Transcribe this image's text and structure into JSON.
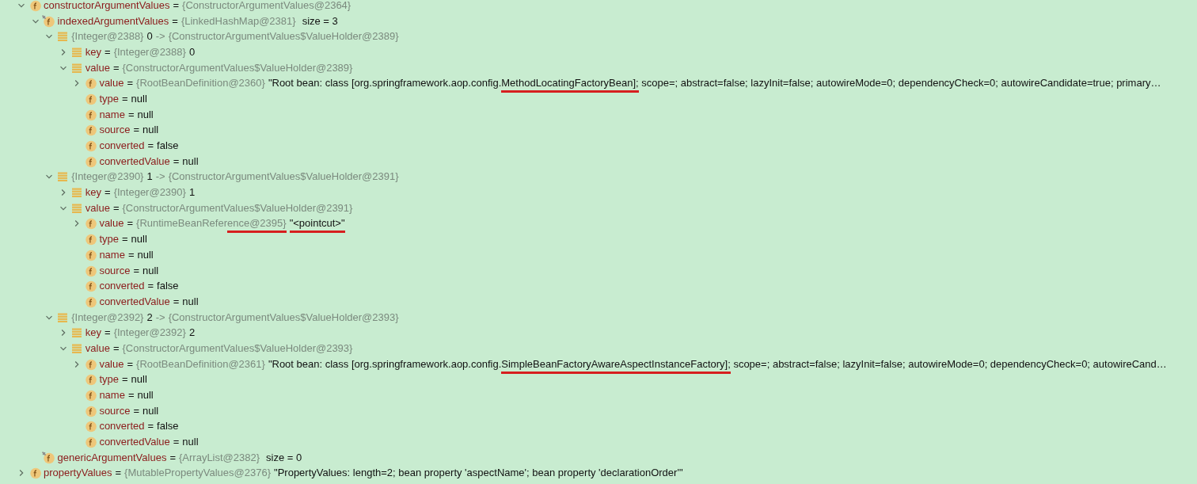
{
  "tree": [
    {
      "kind": "field",
      "expanded": true,
      "parts": [
        {
          "kind": "name",
          "segments": [
            {
              "text": "constructorArgumentValues"
            }
          ]
        },
        {
          "kind": "plain",
          "segments": [
            {
              "text": "="
            }
          ]
        },
        {
          "kind": "type",
          "segments": [
            {
              "text": "{ConstructorArgumentValues@2364}"
            }
          ]
        }
      ],
      "children": [
        {
          "kind": "field_marked",
          "expanded": true,
          "parts": [
            {
              "kind": "name",
              "segments": [
                {
                  "text": "indexedArgumentValues"
                }
              ]
            },
            {
              "kind": "plain",
              "segments": [
                {
                  "text": "="
                }
              ]
            },
            {
              "kind": "type",
              "segments": [
                {
                  "text": "{LinkedHashMap@2381}"
                }
              ]
            },
            {
              "kind": "size",
              "segments": [
                {
                  "text": "size = 3"
                }
              ]
            }
          ],
          "children": [
            {
              "kind": "entry",
              "expanded": true,
              "parts": [
                {
                  "kind": "type",
                  "segments": [
                    {
                      "text": "{Integer@2388}"
                    }
                  ]
                },
                {
                  "kind": "plain",
                  "segments": [
                    {
                      "text": "0"
                    }
                  ]
                },
                {
                  "kind": "type",
                  "segments": [
                    {
                      "text": "->"
                    }
                  ]
                },
                {
                  "kind": "type",
                  "segments": [
                    {
                      "text": "{ConstructorArgumentValues$ValueHolder@2389}"
                    }
                  ]
                }
              ],
              "children": [
                {
                  "kind": "entry",
                  "expanded": false,
                  "parts": [
                    {
                      "kind": "name",
                      "segments": [
                        {
                          "text": "key"
                        }
                      ]
                    },
                    {
                      "kind": "plain",
                      "segments": [
                        {
                          "text": "="
                        }
                      ]
                    },
                    {
                      "kind": "type",
                      "segments": [
                        {
                          "text": "{Integer@2388}"
                        }
                      ]
                    },
                    {
                      "kind": "plain",
                      "segments": [
                        {
                          "text": "0"
                        }
                      ]
                    }
                  ]
                },
                {
                  "kind": "entry",
                  "expanded": true,
                  "parts": [
                    {
                      "kind": "name",
                      "segments": [
                        {
                          "text": "value"
                        }
                      ]
                    },
                    {
                      "kind": "plain",
                      "segments": [
                        {
                          "text": "="
                        }
                      ]
                    },
                    {
                      "kind": "type",
                      "segments": [
                        {
                          "text": "{ConstructorArgumentValues$ValueHolder@2389}"
                        }
                      ]
                    }
                  ],
                  "children": [
                    {
                      "kind": "field",
                      "expanded": false,
                      "parts": [
                        {
                          "kind": "name",
                          "segments": [
                            {
                              "text": "value"
                            }
                          ]
                        },
                        {
                          "kind": "plain",
                          "segments": [
                            {
                              "text": "="
                            }
                          ]
                        },
                        {
                          "kind": "type",
                          "segments": [
                            {
                              "text": "{RootBeanDefinition@2360}"
                            }
                          ]
                        },
                        {
                          "kind": "plain",
                          "segments": [
                            {
                              "text": "\"Root bean: class [org.springframework.aop.config.",
                              "underlined": false
                            },
                            {
                              "text": "MethodLocatingFactoryBean];",
                              "underlined": true
                            },
                            {
                              "text": " scope=; abstract=false; lazyInit=false; autowireMode=0; dependencyCheck=0; autowireCandidate=true; primary…",
                              "underlined": false
                            }
                          ]
                        }
                      ]
                    },
                    {
                      "kind": "field",
                      "parts": [
                        {
                          "kind": "name",
                          "segments": [
                            {
                              "text": "type"
                            }
                          ]
                        },
                        {
                          "kind": "plain",
                          "segments": [
                            {
                              "text": "="
                            }
                          ]
                        },
                        {
                          "kind": "plain",
                          "segments": [
                            {
                              "text": "null"
                            }
                          ]
                        }
                      ]
                    },
                    {
                      "kind": "field",
                      "parts": [
                        {
                          "kind": "name",
                          "segments": [
                            {
                              "text": "name"
                            }
                          ]
                        },
                        {
                          "kind": "plain",
                          "segments": [
                            {
                              "text": "="
                            }
                          ]
                        },
                        {
                          "kind": "plain",
                          "segments": [
                            {
                              "text": "null"
                            }
                          ]
                        }
                      ]
                    },
                    {
                      "kind": "field",
                      "parts": [
                        {
                          "kind": "name",
                          "segments": [
                            {
                              "text": "source"
                            }
                          ]
                        },
                        {
                          "kind": "plain",
                          "segments": [
                            {
                              "text": "="
                            }
                          ]
                        },
                        {
                          "kind": "plain",
                          "segments": [
                            {
                              "text": "null"
                            }
                          ]
                        }
                      ]
                    },
                    {
                      "kind": "field",
                      "parts": [
                        {
                          "kind": "name",
                          "segments": [
                            {
                              "text": "converted"
                            }
                          ]
                        },
                        {
                          "kind": "plain",
                          "segments": [
                            {
                              "text": "="
                            }
                          ]
                        },
                        {
                          "kind": "plain",
                          "segments": [
                            {
                              "text": "false"
                            }
                          ]
                        }
                      ]
                    },
                    {
                      "kind": "field",
                      "parts": [
                        {
                          "kind": "name",
                          "segments": [
                            {
                              "text": "convertedValue"
                            }
                          ]
                        },
                        {
                          "kind": "plain",
                          "segments": [
                            {
                              "text": "="
                            }
                          ]
                        },
                        {
                          "kind": "plain",
                          "segments": [
                            {
                              "text": "null"
                            }
                          ]
                        }
                      ]
                    }
                  ]
                }
              ]
            },
            {
              "kind": "entry",
              "expanded": true,
              "parts": [
                {
                  "kind": "type",
                  "segments": [
                    {
                      "text": "{Integer@2390}"
                    }
                  ]
                },
                {
                  "kind": "plain",
                  "segments": [
                    {
                      "text": "1"
                    }
                  ]
                },
                {
                  "kind": "type",
                  "segments": [
                    {
                      "text": "->"
                    }
                  ]
                },
                {
                  "kind": "type",
                  "segments": [
                    {
                      "text": "{ConstructorArgumentValues$ValueHolder@2391}"
                    }
                  ]
                }
              ],
              "children": [
                {
                  "kind": "entry",
                  "expanded": false,
                  "parts": [
                    {
                      "kind": "name",
                      "segments": [
                        {
                          "text": "key"
                        }
                      ]
                    },
                    {
                      "kind": "plain",
                      "segments": [
                        {
                          "text": "="
                        }
                      ]
                    },
                    {
                      "kind": "type",
                      "segments": [
                        {
                          "text": "{Integer@2390}"
                        }
                      ]
                    },
                    {
                      "kind": "plain",
                      "segments": [
                        {
                          "text": "1"
                        }
                      ]
                    }
                  ]
                },
                {
                  "kind": "entry",
                  "expanded": true,
                  "parts": [
                    {
                      "kind": "name",
                      "segments": [
                        {
                          "text": "value"
                        }
                      ]
                    },
                    {
                      "kind": "plain",
                      "segments": [
                        {
                          "text": "="
                        }
                      ]
                    },
                    {
                      "kind": "type",
                      "segments": [
                        {
                          "text": "{ConstructorArgumentValues$ValueHolder@2391}"
                        }
                      ]
                    }
                  ],
                  "children": [
                    {
                      "kind": "field",
                      "expanded": false,
                      "parts": [
                        {
                          "kind": "name",
                          "segments": [
                            {
                              "text": "value"
                            }
                          ]
                        },
                        {
                          "kind": "plain",
                          "segments": [
                            {
                              "text": "="
                            }
                          ]
                        },
                        {
                          "kind": "type",
                          "segments": [
                            {
                              "text": "{RuntimeBeanRefer",
                              "underlined": false
                            },
                            {
                              "text": "ence@2395}",
                              "underlined": true
                            }
                          ]
                        },
                        {
                          "kind": "plain",
                          "segments": [
                            {
                              "text": "\"<pointcut>\"",
                              "underlined": true
                            }
                          ]
                        }
                      ]
                    },
                    {
                      "kind": "field",
                      "parts": [
                        {
                          "kind": "name",
                          "segments": [
                            {
                              "text": "type"
                            }
                          ]
                        },
                        {
                          "kind": "plain",
                          "segments": [
                            {
                              "text": "="
                            }
                          ]
                        },
                        {
                          "kind": "plain",
                          "segments": [
                            {
                              "text": "null"
                            }
                          ]
                        }
                      ]
                    },
                    {
                      "kind": "field",
                      "parts": [
                        {
                          "kind": "name",
                          "segments": [
                            {
                              "text": "name"
                            }
                          ]
                        },
                        {
                          "kind": "plain",
                          "segments": [
                            {
                              "text": "="
                            }
                          ]
                        },
                        {
                          "kind": "plain",
                          "segments": [
                            {
                              "text": "null"
                            }
                          ]
                        }
                      ]
                    },
                    {
                      "kind": "field",
                      "parts": [
                        {
                          "kind": "name",
                          "segments": [
                            {
                              "text": "source"
                            }
                          ]
                        },
                        {
                          "kind": "plain",
                          "segments": [
                            {
                              "text": "="
                            }
                          ]
                        },
                        {
                          "kind": "plain",
                          "segments": [
                            {
                              "text": "null"
                            }
                          ]
                        }
                      ]
                    },
                    {
                      "kind": "field",
                      "parts": [
                        {
                          "kind": "name",
                          "segments": [
                            {
                              "text": "converted"
                            }
                          ]
                        },
                        {
                          "kind": "plain",
                          "segments": [
                            {
                              "text": "="
                            }
                          ]
                        },
                        {
                          "kind": "plain",
                          "segments": [
                            {
                              "text": "false"
                            }
                          ]
                        }
                      ]
                    },
                    {
                      "kind": "field",
                      "parts": [
                        {
                          "kind": "name",
                          "segments": [
                            {
                              "text": "convertedValue"
                            }
                          ]
                        },
                        {
                          "kind": "plain",
                          "segments": [
                            {
                              "text": "="
                            }
                          ]
                        },
                        {
                          "kind": "plain",
                          "segments": [
                            {
                              "text": "null"
                            }
                          ]
                        }
                      ]
                    }
                  ]
                }
              ]
            },
            {
              "kind": "entry",
              "expanded": true,
              "parts": [
                {
                  "kind": "type",
                  "segments": [
                    {
                      "text": "{Integer@2392}"
                    }
                  ]
                },
                {
                  "kind": "plain",
                  "segments": [
                    {
                      "text": "2"
                    }
                  ]
                },
                {
                  "kind": "type",
                  "segments": [
                    {
                      "text": "->"
                    }
                  ]
                },
                {
                  "kind": "type",
                  "segments": [
                    {
                      "text": "{ConstructorArgumentValues$ValueHolder@2393}"
                    }
                  ]
                }
              ],
              "children": [
                {
                  "kind": "entry",
                  "expanded": false,
                  "parts": [
                    {
                      "kind": "name",
                      "segments": [
                        {
                          "text": "key"
                        }
                      ]
                    },
                    {
                      "kind": "plain",
                      "segments": [
                        {
                          "text": "="
                        }
                      ]
                    },
                    {
                      "kind": "type",
                      "segments": [
                        {
                          "text": "{Integer@2392}"
                        }
                      ]
                    },
                    {
                      "kind": "plain",
                      "segments": [
                        {
                          "text": "2"
                        }
                      ]
                    }
                  ]
                },
                {
                  "kind": "entry",
                  "expanded": true,
                  "parts": [
                    {
                      "kind": "name",
                      "segments": [
                        {
                          "text": "value"
                        }
                      ]
                    },
                    {
                      "kind": "plain",
                      "segments": [
                        {
                          "text": "="
                        }
                      ]
                    },
                    {
                      "kind": "type",
                      "segments": [
                        {
                          "text": "{ConstructorArgumentValues$ValueHolder@2393}"
                        }
                      ]
                    }
                  ],
                  "children": [
                    {
                      "kind": "field",
                      "expanded": false,
                      "parts": [
                        {
                          "kind": "name",
                          "segments": [
                            {
                              "text": "value"
                            }
                          ]
                        },
                        {
                          "kind": "plain",
                          "segments": [
                            {
                              "text": "="
                            }
                          ]
                        },
                        {
                          "kind": "type",
                          "segments": [
                            {
                              "text": "{RootBeanDefinition@2361}"
                            }
                          ]
                        },
                        {
                          "kind": "plain",
                          "segments": [
                            {
                              "text": "\"Root bean: class [org.springframework.aop.config.",
                              "underlined": false
                            },
                            {
                              "text": "SimpleBeanFactoryAwareAspectInstanceFactory];",
                              "underlined": true
                            },
                            {
                              "text": " scope=; abstract=false; lazyInit=false; autowireMode=0; dependencyCheck=0; autowireCand…",
                              "underlined": false
                            }
                          ]
                        }
                      ]
                    },
                    {
                      "kind": "field",
                      "parts": [
                        {
                          "kind": "name",
                          "segments": [
                            {
                              "text": "type"
                            }
                          ]
                        },
                        {
                          "kind": "plain",
                          "segments": [
                            {
                              "text": "="
                            }
                          ]
                        },
                        {
                          "kind": "plain",
                          "segments": [
                            {
                              "text": "null"
                            }
                          ]
                        }
                      ]
                    },
                    {
                      "kind": "field",
                      "parts": [
                        {
                          "kind": "name",
                          "segments": [
                            {
                              "text": "name"
                            }
                          ]
                        },
                        {
                          "kind": "plain",
                          "segments": [
                            {
                              "text": "="
                            }
                          ]
                        },
                        {
                          "kind": "plain",
                          "segments": [
                            {
                              "text": "null"
                            }
                          ]
                        }
                      ]
                    },
                    {
                      "kind": "field",
                      "parts": [
                        {
                          "kind": "name",
                          "segments": [
                            {
                              "text": "source"
                            }
                          ]
                        },
                        {
                          "kind": "plain",
                          "segments": [
                            {
                              "text": "="
                            }
                          ]
                        },
                        {
                          "kind": "plain",
                          "segments": [
                            {
                              "text": "null"
                            }
                          ]
                        }
                      ]
                    },
                    {
                      "kind": "field",
                      "parts": [
                        {
                          "kind": "name",
                          "segments": [
                            {
                              "text": "converted"
                            }
                          ]
                        },
                        {
                          "kind": "plain",
                          "segments": [
                            {
                              "text": "="
                            }
                          ]
                        },
                        {
                          "kind": "plain",
                          "segments": [
                            {
                              "text": "false"
                            }
                          ]
                        }
                      ]
                    },
                    {
                      "kind": "field",
                      "parts": [
                        {
                          "kind": "name",
                          "segments": [
                            {
                              "text": "convertedValue"
                            }
                          ]
                        },
                        {
                          "kind": "plain",
                          "segments": [
                            {
                              "text": "="
                            }
                          ]
                        },
                        {
                          "kind": "plain",
                          "segments": [
                            {
                              "text": "null"
                            }
                          ]
                        }
                      ]
                    }
                  ]
                }
              ]
            }
          ]
        },
        {
          "kind": "field_marked",
          "parts": [
            {
              "kind": "name",
              "segments": [
                {
                  "text": "genericArgumentValues"
                }
              ]
            },
            {
              "kind": "plain",
              "segments": [
                {
                  "text": "="
                }
              ]
            },
            {
              "kind": "type",
              "segments": [
                {
                  "text": "{ArrayList@2382}"
                }
              ]
            },
            {
              "kind": "size",
              "segments": [
                {
                  "text": "size = 0"
                }
              ]
            }
          ]
        }
      ]
    },
    {
      "kind": "field",
      "expanded": false,
      "parts": [
        {
          "kind": "name",
          "segments": [
            {
              "text": "propertyValues"
            }
          ]
        },
        {
          "kind": "plain",
          "segments": [
            {
              "text": "="
            }
          ]
        },
        {
          "kind": "type",
          "segments": [
            {
              "text": "{MutablePropertyValues@2376}"
            }
          ]
        },
        {
          "kind": "plain",
          "segments": [
            {
              "text": "\"PropertyValues: length=2; bean property 'aspectName'; bean property 'declarationOrder'\""
            }
          ]
        }
      ]
    }
  ]
}
